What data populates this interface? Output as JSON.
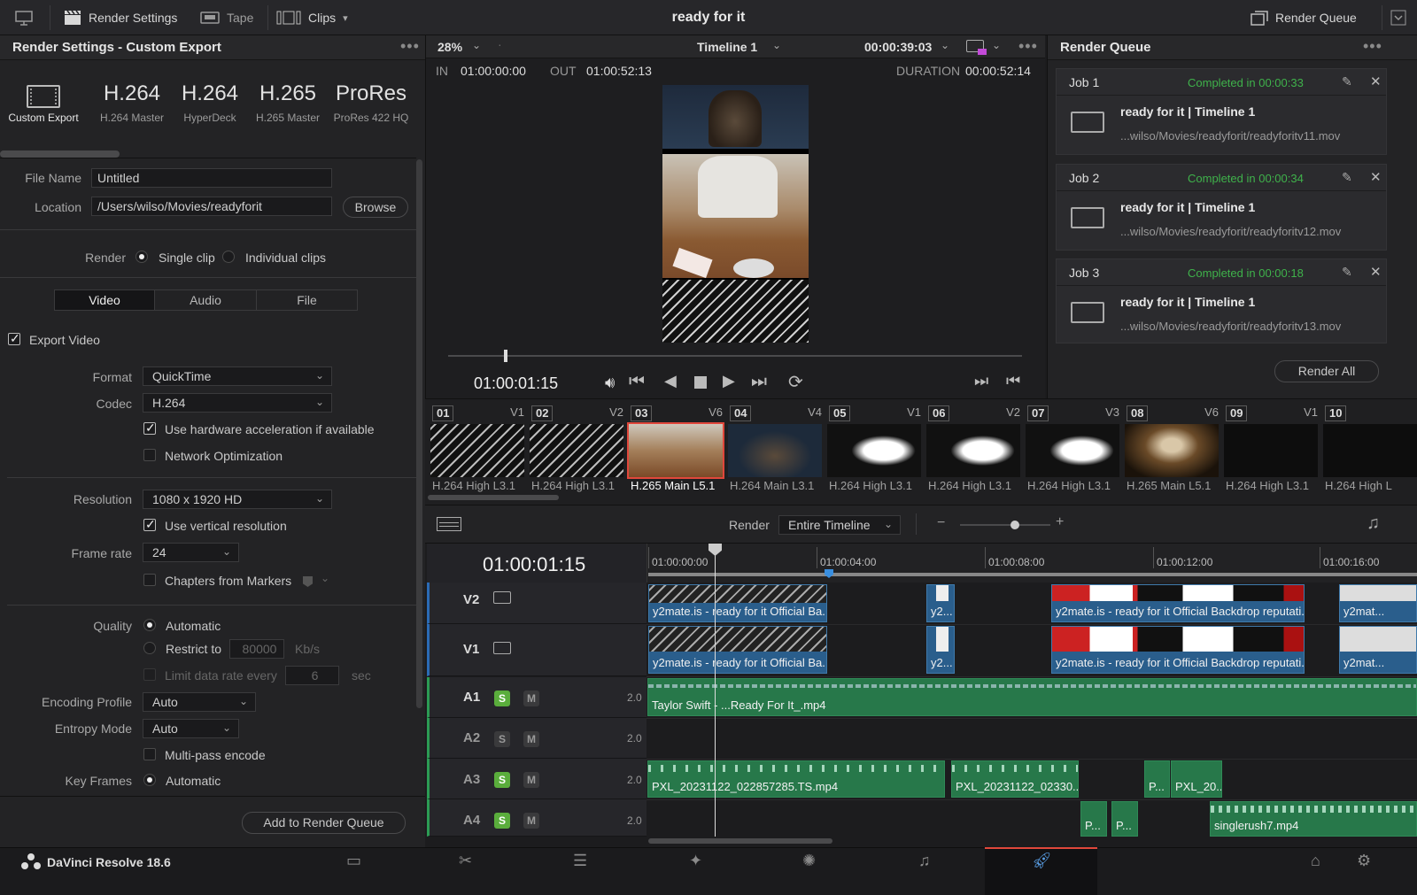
{
  "topbar": {
    "render_settings": "Render Settings",
    "tape": "Tape",
    "clips": "Clips",
    "project_title": "ready for it",
    "render_queue": "Render Queue"
  },
  "settings": {
    "header": "Render Settings - Custom Export",
    "presets": [
      {
        "big": "",
        "small": "Custom Export"
      },
      {
        "big": "H.264",
        "small": "H.264 Master"
      },
      {
        "big": "H.264",
        "small": "HyperDeck"
      },
      {
        "big": "H.265",
        "small": "H.265 Master"
      },
      {
        "big": "ProRes",
        "small": "ProRes 422 HQ"
      }
    ],
    "file_name_label": "File Name",
    "file_name_value": "Untitled",
    "location_label": "Location",
    "location_value": "/Users/wilso/Movies/readyforit",
    "browse": "Browse",
    "render_label": "Render",
    "single_clip": "Single clip",
    "individual_clips": "Individual clips",
    "tabs": [
      "Video",
      "Audio",
      "File"
    ],
    "export_video": "Export Video",
    "format_label": "Format",
    "format_value": "QuickTime",
    "codec_label": "Codec",
    "codec_value": "H.264",
    "hw_accel": "Use hardware acceleration if available",
    "network_opt": "Network Optimization",
    "resolution_label": "Resolution",
    "resolution_value": "1080 x 1920 HD",
    "vertical_res": "Use vertical resolution",
    "framerate_label": "Frame rate",
    "framerate_value": "24",
    "chapters": "Chapters from Markers",
    "quality_label": "Quality",
    "automatic": "Automatic",
    "restrict_to": "Restrict to",
    "restrict_value": "80000",
    "kbs": "Kb/s",
    "limit_rate": "Limit data rate every",
    "limit_value": "6",
    "sec": "sec",
    "enc_profile_label": "Encoding Profile",
    "enc_profile_value": "Auto",
    "entropy_label": "Entropy Mode",
    "entropy_value": "Auto",
    "multipass": "Multi-pass encode",
    "keyframes_label": "Key Frames",
    "keyframes_value": "Automatic",
    "add_queue": "Add to Render Queue"
  },
  "viewer": {
    "zoom": "28%",
    "timeline_name": "Timeline 1",
    "timecode_top": "00:00:39:03",
    "in_label": "IN",
    "in_value": "01:00:00:00",
    "out_label": "OUT",
    "out_value": "01:00:52:13",
    "duration_label": "DURATION",
    "duration_value": "00:00:52:14",
    "current_tc": "01:00:01:15",
    "scrub_progress": 0.1
  },
  "queue": {
    "header": "Render Queue",
    "jobs": [
      {
        "name": "Job 1",
        "status": "Completed in 00:00:33",
        "title": "ready for it | Timeline 1",
        "file": "...wilso/Movies/readyforit/readyforitv11.mov"
      },
      {
        "name": "Job 2",
        "status": "Completed in 00:00:34",
        "title": "ready for it | Timeline 1",
        "file": "...wilso/Movies/readyforit/readyforitv12.mov"
      },
      {
        "name": "Job 3",
        "status": "Completed in 00:00:18",
        "title": "ready for it | Timeline 1",
        "file": "...wilso/Movies/readyforit/readyforitv13.mov"
      }
    ],
    "render_all": "Render All"
  },
  "clips": [
    {
      "num": "01",
      "track": "V1",
      "codec": "H.264 High L3.1"
    },
    {
      "num": "02",
      "track": "V2",
      "codec": "H.264 High L3.1"
    },
    {
      "num": "03",
      "track": "V6",
      "codec": "H.265 Main L5.1"
    },
    {
      "num": "04",
      "track": "V4",
      "codec": "H.264 Main L3.1"
    },
    {
      "num": "05",
      "track": "V1",
      "codec": "H.264 High L3.1"
    },
    {
      "num": "06",
      "track": "V2",
      "codec": "H.264 High L3.1"
    },
    {
      "num": "07",
      "track": "V3",
      "codec": "H.264 High L3.1"
    },
    {
      "num": "08",
      "track": "V6",
      "codec": "H.265 Main L5.1"
    },
    {
      "num": "09",
      "track": "V1",
      "codec": "H.264 High L3.1"
    },
    {
      "num": "10",
      "track": "",
      "codec": "H.264 High L"
    }
  ],
  "timeline": {
    "render_label": "Render",
    "render_value": "Entire Timeline",
    "timecode": "01:00:01:15",
    "ticks": [
      "01:00:00:00",
      "01:00:04:00",
      "01:00:08:00",
      "01:00:12:00",
      "01:00:16:00"
    ],
    "tracks": [
      {
        "name": "V2",
        "level": ""
      },
      {
        "name": "V1",
        "level": ""
      },
      {
        "name": "A1",
        "level": "2.0"
      },
      {
        "name": "A2",
        "level": "2.0"
      },
      {
        "name": "A3",
        "level": "2.0"
      },
      {
        "name": "A4",
        "level": "2.0"
      }
    ],
    "s_label": "S",
    "m_label": "M",
    "clip_labels": {
      "v_a": "y2mate.is - ready for it Official Ba...",
      "v_b": "y2...",
      "v_c": "y2mate.is - ready for it Official Backdrop reputati...",
      "v_d": "y2mat...",
      "a1": "Taylor Swift - ...Ready For It_.mp4",
      "a3_a": "PXL_20231122_022857285.TS.mp4",
      "a3_b": "PXL_20231122_02330...",
      "a3_c": "P...",
      "a3_d": "PXL_20...",
      "a4_a": "P...",
      "a4_b": "P...",
      "a4_c": "singlerush7.mp4"
    }
  },
  "footer": {
    "app_name": "DaVinci Resolve 18.6"
  },
  "colors": {
    "accent": "#e0473b",
    "video_clip": "#2a5e8c",
    "audio_clip": "#27784a",
    "completed": "#3fb24b"
  }
}
